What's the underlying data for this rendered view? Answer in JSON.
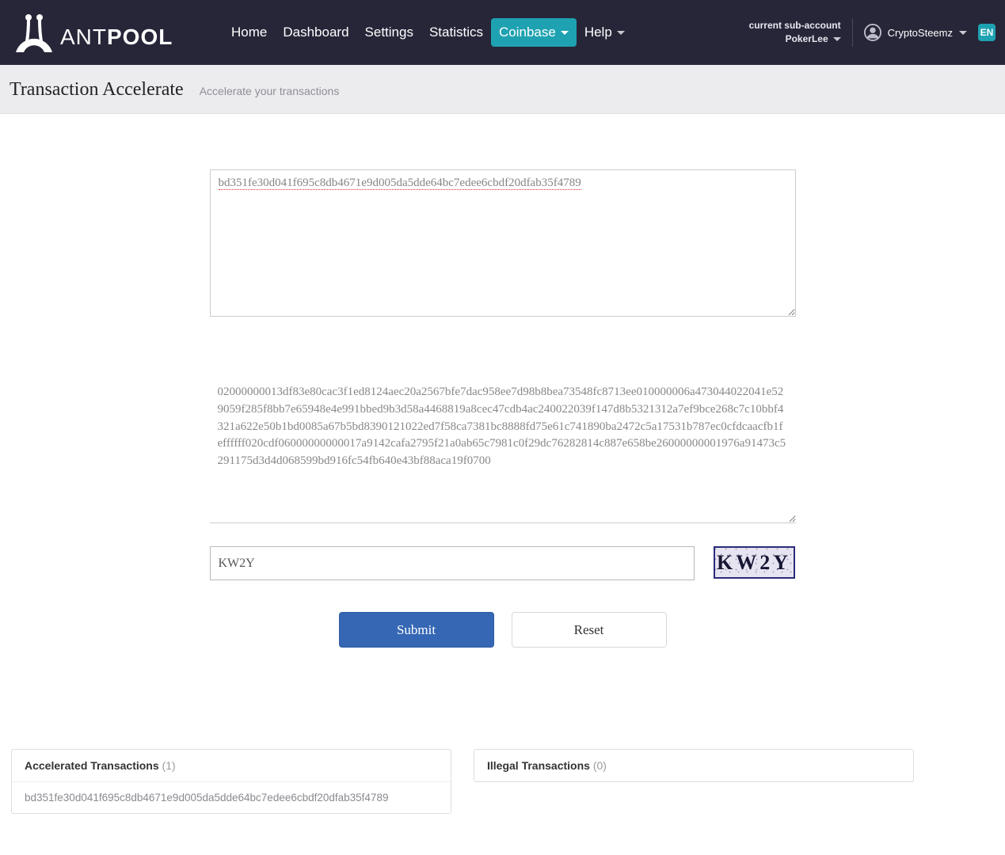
{
  "brand": {
    "name_a": "ANT",
    "name_b": "POOL"
  },
  "nav": {
    "home": "Home",
    "dashboard": "Dashboard",
    "settings": "Settings",
    "statistics": "Statistics",
    "coinbase": "Coinbase",
    "help": "Help"
  },
  "account": {
    "current_label": "current sub-account",
    "sub_account": "PokerLee",
    "username": "CryptoSteemz",
    "lang": "EN"
  },
  "page": {
    "title": "Transaction Accelerate",
    "subtitle": "Accelerate your transactions"
  },
  "form": {
    "txid_value": "bd351fe30d041f695c8db4671e9d005da5dde64bc7edee6cbdf20dfab35f4789",
    "rawtx_value": "02000000013df83e80cac3f1ed8124aec20a2567bfe7dac958ee7d98b8bea73548fc8713ee010000006a473044022041e529059f285f8bb7e65948e4e991bbed9b3d58a4468819a8cec47cdb4ac240022039f147d8b5321312a7ef9bce268c7c10bbf4321a622e50b1bd0085a67b5bd8390121022ed7f58ca7381bc8888fd75e61c741890ba2472c5a17531b787ec0cfdcaacfb1feffffff020cdf06000000000017a9142cafa2795f21a0ab65c7981c0f29dc76282814c887e658be26000000001976a91473c5291175d3d4d068599bd916fc54fb640e43bf88aca19f0700",
    "captcha_value": "KW2Y",
    "captcha_image_text": "KW2Y",
    "submit": "Submit",
    "reset": "Reset"
  },
  "panels": {
    "accelerated": {
      "title": "Accelerated Transactions",
      "count": "(1)",
      "items": [
        "bd351fe30d041f695c8db4671e9d005da5dde64bc7edee6cbdf20dfab35f4789"
      ]
    },
    "illegal": {
      "title": "Illegal Transactions",
      "count": "(0)"
    }
  }
}
